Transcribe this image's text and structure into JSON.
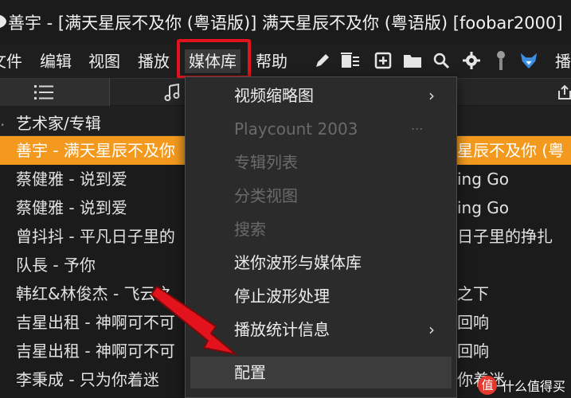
{
  "window": {
    "title": "善宇 - [满天星辰不及你 (粤语版)] 满天星辰不及你 (粤语版)  [foobar2000]"
  },
  "menubar": {
    "items": [
      "文件",
      "编辑",
      "视图",
      "播放",
      "媒体库",
      "帮助"
    ],
    "active_index": 4,
    "highlight_color": "#e3131e"
  },
  "toolbar": {
    "icons": [
      "pencil-icon",
      "delete-list-icon",
      "add-icon",
      "folder-icon",
      "search-icon",
      "gear-icon",
      "microphone-icon",
      "fox-icon"
    ],
    "overflow_label": "播"
  },
  "columns": {
    "header": "艺术家/专辑",
    "left_edge": "."
  },
  "rows": [
    {
      "left": "善宇 - 满天星辰不及你",
      "right": "星辰不及你 (粤",
      "selected": true
    },
    {
      "left": "蔡健雅 - 说到爱",
      "right": "ing Go",
      "selected": false
    },
    {
      "left": "蔡健雅 - 说到爱",
      "right": "ing Go",
      "selected": false
    },
    {
      "left": "曾抖抖 - 平凡日子里的",
      "right": "日子里的挣扎",
      "selected": false
    },
    {
      "left": "队長 - 予你",
      "right": "",
      "selected": false
    },
    {
      "left": "韩红&林俊杰 - 飞云之",
      "right": "之下",
      "selected": false
    },
    {
      "left": "吉星出租 - 神啊可不可",
      "right": "回响",
      "selected": false
    },
    {
      "left": "吉星出租 - 神啊可不可",
      "right": "回响",
      "selected": false
    },
    {
      "left": "李秉成 - 只为你着迷",
      "right": "你着迷",
      "selected": false
    }
  ],
  "dropdown": {
    "items": [
      {
        "label": "视频缩略图",
        "enabled": true,
        "submenu": true
      },
      {
        "label": "Playcount 2003",
        "enabled": false,
        "submenu": false,
        "ellipsis": "..."
      },
      {
        "label": "专辑列表",
        "enabled": false,
        "submenu": false
      },
      {
        "label": "分类视图",
        "enabled": false,
        "submenu": false
      },
      {
        "label": "搜索",
        "enabled": false,
        "submenu": false
      },
      {
        "label": "迷你波形与媒体库",
        "enabled": true,
        "submenu": false
      },
      {
        "label": "停止波形处理",
        "enabled": true,
        "submenu": false
      },
      {
        "label": "播放统计信息",
        "enabled": true,
        "submenu": true
      },
      {
        "label": "配置",
        "enabled": true,
        "submenu": false,
        "hovered": true
      }
    ],
    "submenu_arrow": "›"
  },
  "watermark": {
    "badge": "值",
    "text": "什么值得买"
  },
  "colors": {
    "selected_row": "#f39a1e",
    "annotation_red": "#e3131e",
    "menu_bg": "#2b2b2b"
  }
}
